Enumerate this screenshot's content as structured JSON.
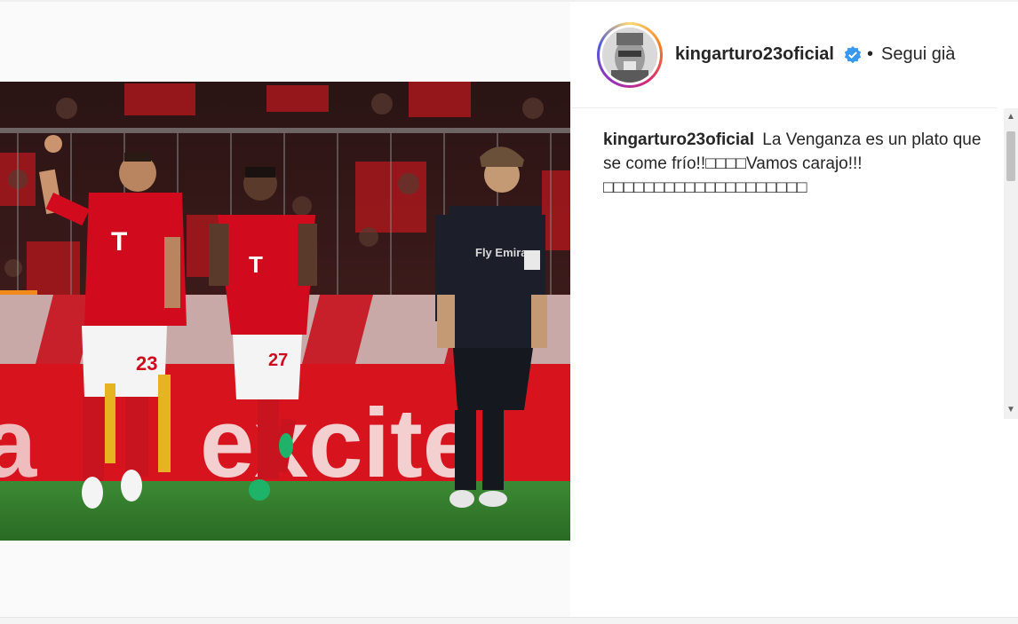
{
  "post": {
    "username": "kingarturo23oficial",
    "separator": "•",
    "follow_status": "Segui già",
    "caption_user": "kingarturo23oficial",
    "caption_text": "La Venganza es un plato que se come frío!!□□□□Vamos carajo!!!□□□□□□□□□□□□□□□□□□□□"
  },
  "photo": {
    "jersey_numbers": [
      "23",
      "27"
    ],
    "sponsor_text": "Fly Emirates",
    "board_text": "excite"
  },
  "icons": {
    "verified": "verified-badge-icon",
    "scroll_up": "scroll-up-arrow-icon",
    "scroll_down": "scroll-down-arrow-icon"
  },
  "colors": {
    "verified_blue": "#3897f0",
    "bayern_red": "#d20a1e",
    "madrid_dark": "#1c1f2a",
    "pitch_green": "#2f7a2a",
    "text": "#262626"
  }
}
